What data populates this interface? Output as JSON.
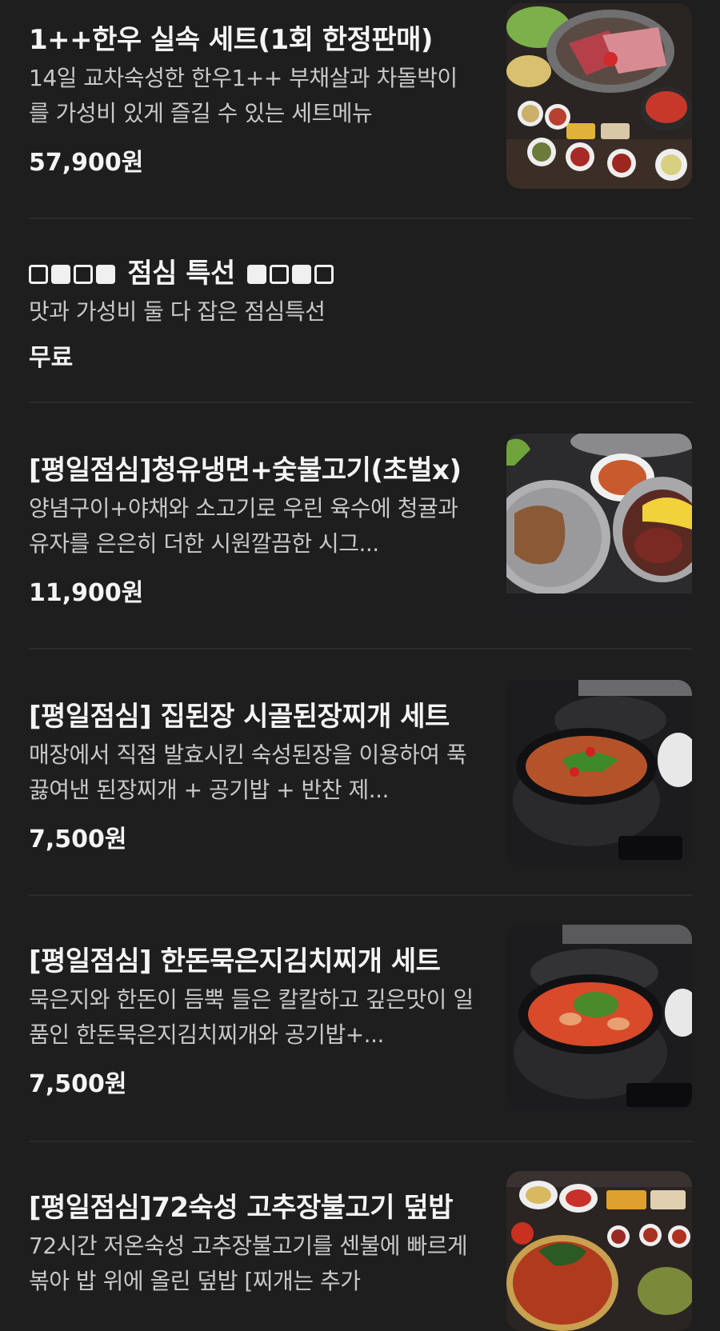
{
  "menu": {
    "items": [
      {
        "title": "1++한우 실속 세트(1회 한정판매)",
        "description": "14일 교차숙성한 한우1++ 부채살과 차돌박이를 가성비 있게 즐길 수 있는 세트메뉴",
        "price": "57,900원",
        "image": "hanwoo-set-photo"
      },
      {
        "title_text": "점심 특선",
        "title_prefix_squares": [
          "outline",
          "filled",
          "outline",
          "filled"
        ],
        "title_suffix_squares": [
          "filled",
          "outline",
          "filled",
          "outline"
        ],
        "description": "맛과 가성비 둘 다 잡은 점심특선",
        "price": "무료"
      },
      {
        "title": "[평일점심]청유냉면+숯불고기(초벌x)",
        "description": "양념구이+야채와 소고기로 우린 육수에 청귤과 유자를 은은히 더한 시원깔끔한 시그...",
        "price": "11,900원",
        "image": "naengmyeon-bulgogi-photo"
      },
      {
        "title": "[평일점심] 집된장 시골된장찌개 세트",
        "description": "매장에서 직접 발효시킨 숙성된장을 이용하여 푹 끓여낸 된장찌개 + 공기밥 + 반찬 제...",
        "price": "7,500원",
        "image": "doenjang-jjigae-photo"
      },
      {
        "title": "[평일점심] 한돈묵은지김치찌개 세트",
        "description": "묵은지와 한돈이 듬뿍 들은 칼칼하고 깊은맛이 일품인 한돈묵은지김치찌개와 공기밥+...",
        "price": "7,500원",
        "image": "kimchi-jjigae-photo"
      },
      {
        "title": "[평일점심]72숙성 고추장불고기 덮밥",
        "description": "72시간 저온숙성 고추장불고기를 센불에 빠르게 볶아 밥 위에 올린 덮밥 [찌개는 추가",
        "price": "",
        "image": "gochujang-bulgogi-photo"
      }
    ]
  },
  "colors": {
    "background": "#1e1e1e",
    "title": "#f4f4f4",
    "description": "#c8c8c8",
    "divider": "#2c2c2c"
  }
}
